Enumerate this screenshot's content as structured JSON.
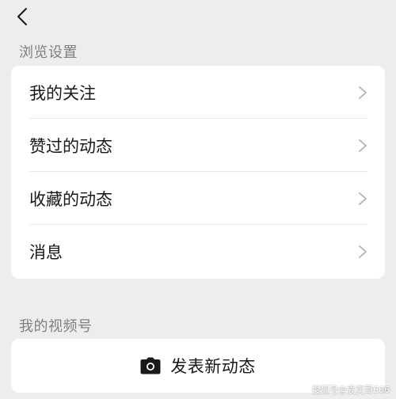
{
  "nav": {
    "back_icon": "chevron-left-icon"
  },
  "browse_settings": {
    "title": "浏览设置",
    "items": [
      {
        "label": "我的关注",
        "icon": "chevron-right-icon"
      },
      {
        "label": "赞过的动态",
        "icon": "chevron-right-icon"
      },
      {
        "label": "收藏的动态",
        "icon": "chevron-right-icon"
      },
      {
        "label": "消息",
        "icon": "chevron-right-icon"
      }
    ]
  },
  "my_channel": {
    "title": "我的视频号",
    "publish_label": "发表新动态",
    "publish_icon": "camera-icon"
  },
  "watermark": "搜狐号@袁奕哥666",
  "colors": {
    "background": "#ededed",
    "card": "#ffffff",
    "section_title": "#7f7f7f",
    "text": "#191919",
    "chevron": "#b2b2b2"
  }
}
